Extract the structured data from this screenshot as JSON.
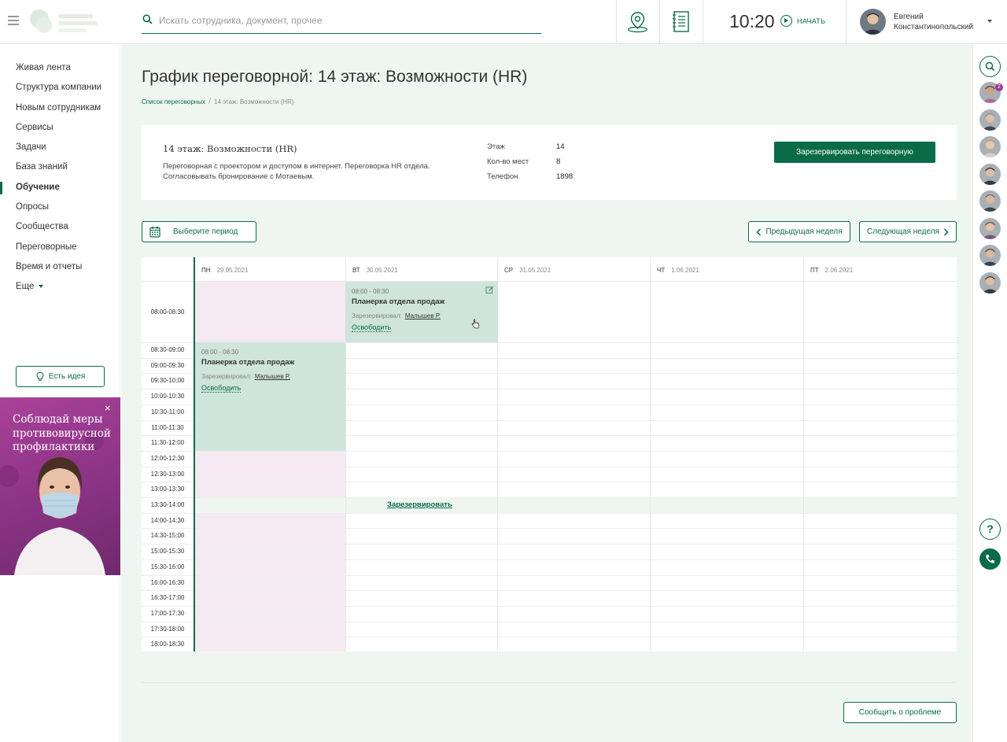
{
  "header": {
    "search_placeholder": "Искать сотрудника, документ, прочее",
    "time": "10:20",
    "start_label": "НАЧАТЬ",
    "user_first": "Евгений",
    "user_last": "Константинопольский"
  },
  "sidebar": {
    "items": [
      {
        "label": "Живая лента"
      },
      {
        "label": "Структура компании"
      },
      {
        "label": "Новым сотрудникам"
      },
      {
        "label": "Сервисы"
      },
      {
        "label": "Задачи"
      },
      {
        "label": "База знаний"
      },
      {
        "label": "Обучение",
        "active": true
      },
      {
        "label": "Опросы"
      },
      {
        "label": "Сообщества"
      },
      {
        "label": "Переговорные"
      },
      {
        "label": "Время и отчеты"
      },
      {
        "label": "Еще"
      }
    ],
    "idea_label": "Есть идея",
    "promo_text": "Соблюдай меры противовирусной профилактики",
    "promo_close": "×"
  },
  "page": {
    "title": "График переговорной: 14 этаж: Возможности (HR)",
    "breadcrumb_link": "Список переговорных",
    "breadcrumb_sep": "/",
    "breadcrumb_current": "14 этаж: Возможности (HR)"
  },
  "room": {
    "name": "14 этаж: Возможности (HR)",
    "desc_line1": "Переговорная с проектором и доступом в интернет. Переговорка HR отдела.",
    "desc_line2": "Согласовывать бронирование с Мотаевым.",
    "props": [
      {
        "key": "Этаж",
        "value": "14"
      },
      {
        "key": "Кол-во мест",
        "value": "8"
      },
      {
        "key": "Телефон",
        "value": "1898"
      }
    ],
    "reserve_label": "Зарезервировать переговорную"
  },
  "controls": {
    "period_label": "Выберите период",
    "prev_week": "Предыдущая неделя",
    "next_week": "Следующая неделя"
  },
  "schedule": {
    "days": [
      {
        "dow": "ПН",
        "date": "29.05.2021"
      },
      {
        "dow": "ВТ",
        "date": "30.05.2021"
      },
      {
        "dow": "СР",
        "date": "31.05.2021"
      },
      {
        "dow": "ЧТ",
        "date": "1.06.2021"
      },
      {
        "dow": "ПТ",
        "date": "2.06.2021"
      }
    ],
    "slots": [
      "08:00-08:30",
      "08:30-09:00",
      "09:00-09:30",
      "09:30-10:00",
      "10:00-10:30",
      "10:30-11:00",
      "11:00-11:30",
      "11:30-12:00",
      "12:00-12:30",
      "12:30-13:00",
      "13:00-13:30",
      "13:30-14:00",
      "14:00-14:30",
      "14:30-15:00",
      "15:00-15:30",
      "15:30-16:00",
      "16:00-16:30",
      "16:30-17:00",
      "17:00-17:30",
      "17:30-18:00",
      "18:00-18:30"
    ],
    "reserve_link": "Зарезервировать",
    "bookings": [
      {
        "time": "08:00 - 08:30",
        "name": "Планерка отдела продаж",
        "by_label": "Зарезервировал:",
        "by_name": "Малышев Р.",
        "free_label": "Освободить"
      },
      {
        "time": "08:00 - 08:30",
        "name": "Планерка отдела продаж",
        "by_label": "Зарезервировал:",
        "by_name": "Малышев Р.",
        "free_label": "Освободить"
      }
    ]
  },
  "footer": {
    "report_label": "Сообщить о проблеме"
  },
  "rightbar": {
    "badge": "2",
    "help": "?"
  }
}
